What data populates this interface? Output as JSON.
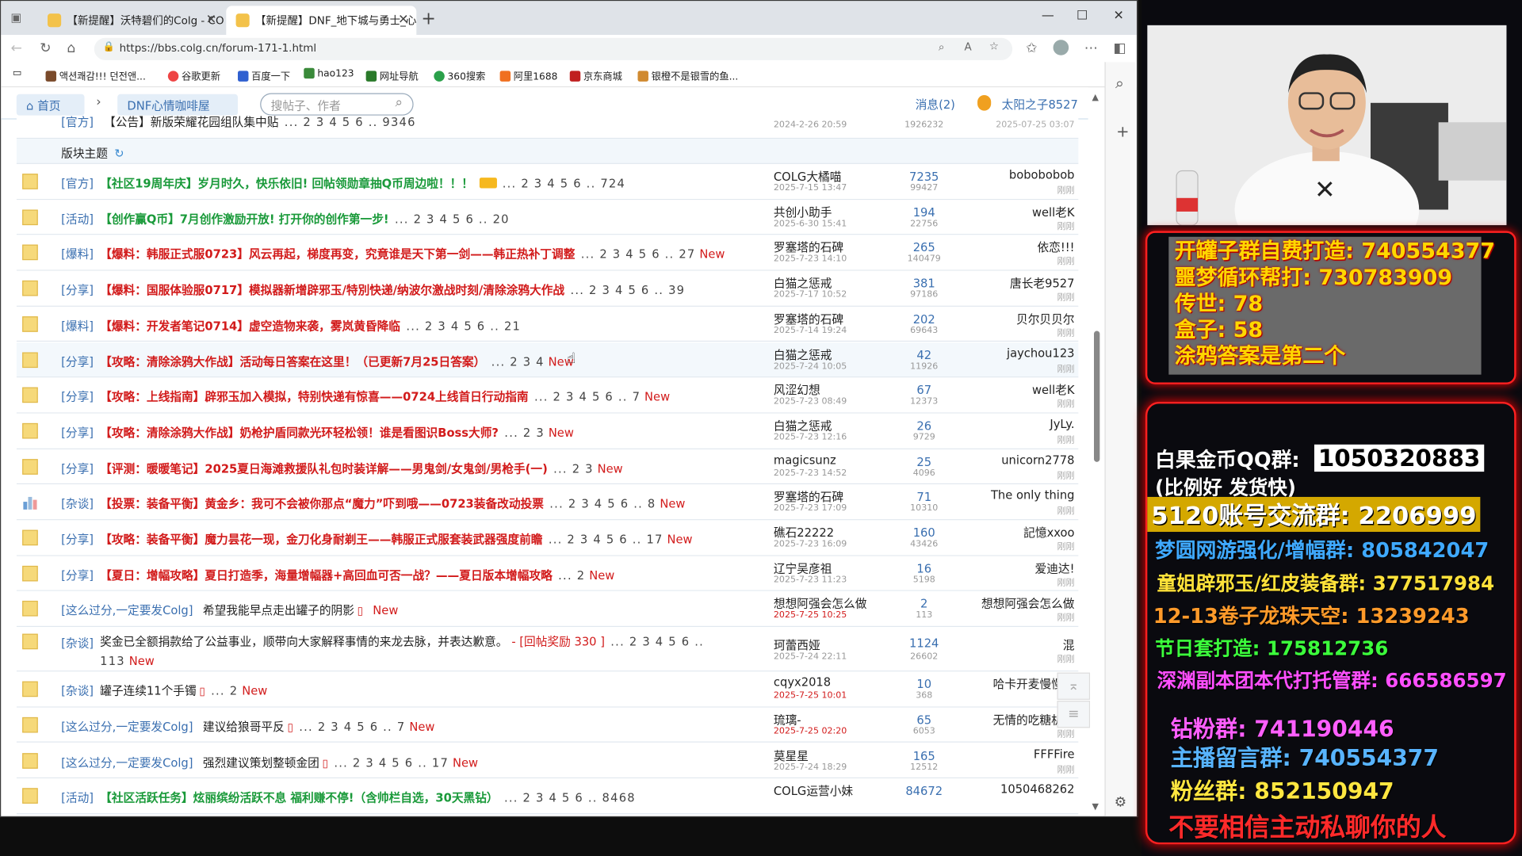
{
  "browser": {
    "tabs": [
      {
        "title": "【新提醒】沃特碧们的Colg - COL"
      },
      {
        "title": "【新提醒】DNF_地下城与勇士_心"
      }
    ],
    "url": "https://bbs.colg.cn/forum-171-1.html",
    "bookmarks": [
      "액션쾌감!!! 던전앤...",
      "谷歌更新",
      "百度一下",
      "hao123",
      "网址导航",
      "360搜索",
      "阿里1688",
      "京东商城",
      "银橙不是银雪的鱼..."
    ]
  },
  "site": {
    "home": "首页",
    "forum": "DNF心情咖啡屋",
    "search_placeholder": "搜帖子、作者",
    "messages": "消息(2)",
    "user": "太阳之子8527",
    "section_label": "版块主题"
  },
  "pinned": {
    "cat": "[官方]",
    "title": "【公告】新版荣耀花园组队集中贴",
    "pages": "... 2 3 4 5 6 .. 9346",
    "date": "2024-2-26 20:59",
    "views": "1926232",
    "lastdate": "2025-07-25 03:07"
  },
  "threads": [
    {
      "cat": "[官方]",
      "title": "【社区19周年庆】岁月时久，快乐依旧! 回帖领勋章抽Q币周边啦！！！",
      "pages": "... 2 3 4 5 6 .. 724",
      "new": "",
      "author": "COLG大橘喵",
      "date": "2025-7-15 13:47",
      "replies": "7235",
      "views": "99427",
      "last": "bobobobob",
      "lt": "刚刚",
      "kind": "green"
    },
    {
      "cat": "[活动]",
      "title": "【创作赢Q币】7月创作激励开放! 打开你的创作第一步!",
      "pages": "... 2 3 4 5 6 .. 20",
      "new": "",
      "author": "共创小助手",
      "date": "2025-6-30 15:41",
      "replies": "194",
      "views": "22756",
      "last": "well老K",
      "lt": "刚刚",
      "kind": "green"
    },
    {
      "cat": "[爆料]",
      "title": "【爆料：韩服正式服0723】风云再起，梯度再变，究竟谁是天下第一剑——韩正热补丁调整",
      "pages": "... 2 3 4 5 6 .. 27",
      "new": "New",
      "author": "罗塞塔的石碑",
      "date": "2025-7-23 14:10",
      "replies": "265",
      "views": "140479",
      "last": "依恋!!!",
      "lt": "刚刚",
      "kind": "blue"
    },
    {
      "cat": "[分享]",
      "title": "【爆料：国服体验服0717】模拟器新增辟邪玉/特別快递/纳波尔激战时刻/清除涂鸦大作战",
      "pages": "... 2 3 4 5 6 .. 39",
      "new": "",
      "author": "白猫之惩戒",
      "date": "2025-7-17 10:52",
      "replies": "381",
      "views": "97186",
      "last": "唐长老9527",
      "lt": "刚刚",
      "kind": "blue"
    },
    {
      "cat": "[爆料]",
      "title": "【爆料：开发者笔记0714】虚空造物来袭，雾岚黄昏降临",
      "pages": "... 2 3 4 5 6 .. 21",
      "new": "",
      "author": "罗塞塔的石碑",
      "date": "2025-7-14 19:24",
      "replies": "202",
      "views": "69643",
      "last": "贝尔贝贝尔",
      "lt": "刚刚",
      "kind": "blue"
    },
    {
      "cat": "[分享]",
      "title": "【攻略：清除涂鸦大作战】活动每日答案在这里！（已更新7月25日答案）",
      "pages": "... 2 3 4",
      "new": "New",
      "author": "白猫之惩戒",
      "date": "2025-7-24 10:05",
      "replies": "42",
      "views": "11926",
      "last": "jaychou123",
      "lt": "刚刚",
      "kind": "red"
    },
    {
      "cat": "[分享]",
      "title": "【攻略：上线指南】辟邪玉加入模拟，特别快递有惊喜——0724上线首日行动指南",
      "pages": "... 2 3 4 5 6 .. 7",
      "new": "New",
      "author": "风涩幻想",
      "date": "2025-7-23 08:49",
      "replies": "67",
      "views": "12373",
      "last": "well老K",
      "lt": "刚刚",
      "kind": "red"
    },
    {
      "cat": "[分享]",
      "title": "【攻略：清除涂鸦大作战】奶枪护盾同款光环轻松领！谁是看图识Boss大师?",
      "pages": "... 2 3",
      "new": "New",
      "author": "白猫之惩戒",
      "date": "2025-7-23 12:16",
      "replies": "26",
      "views": "9729",
      "last": "JyLy.",
      "lt": "刚刚",
      "kind": "red"
    },
    {
      "cat": "[分享]",
      "title": "【评测：暖暖笔记】2025夏日海滩救援队礼包时装详解——男鬼剑/女鬼剑/男枪手(一)",
      "pages": "... 2 3",
      "new": "New",
      "author": "magicsunz",
      "date": "2025-7-23 14:52",
      "replies": "25",
      "views": "4096",
      "last": "unicorn2778",
      "lt": "刚刚",
      "kind": "red"
    },
    {
      "cat": "[杂谈]",
      "title": "【投票：装备平衡】黄金乡：我可不会被你那点“魔力”吓到哦——0723装备改动投票",
      "pages": "... 2 3 4 5 6 .. 8",
      "new": "New",
      "author": "罗塞塔的石碑",
      "date": "2025-7-23 17:09",
      "replies": "71",
      "views": "10310",
      "last": "The only thing",
      "lt": "刚刚",
      "kind": "red",
      "poll": true
    },
    {
      "cat": "[分享]",
      "title": "【攻略：装备平衡】魔力昙花一现，金刀化身耐剃王——韩服正式服套装武器强度前瞻",
      "pages": "... 2 3 4 5 6 .. 17",
      "new": "New",
      "author": "礁石22222",
      "date": "2025-7-23 16:09",
      "replies": "160",
      "views": "43426",
      "last": "記憶xxoo",
      "lt": "刚刚",
      "kind": "red"
    },
    {
      "cat": "[分享]",
      "title": "【夏日：增幅攻略】夏日打造季，海量增幅器+高回血可否一战？——夏日版本增幅攻略",
      "pages": "... 2",
      "new": "New",
      "author": "辽宁吴彦祖",
      "date": "2025-7-23 11:23",
      "replies": "16",
      "views": "5198",
      "last": "爱迪达!",
      "lt": "刚刚",
      "kind": "red"
    },
    {
      "cat": "[这么过分,一定要发Colg]",
      "title": "希望我能早点走出罐子的阴影",
      "pages": "",
      "new": "New",
      "author": "想想阿强会怎么做",
      "date": "2025-7-25 10:25",
      "replies": "2",
      "views": "113",
      "last": "想想阿强会怎么做",
      "lt": "刚刚",
      "kind": "normal",
      "phone": true,
      "reddate": true
    },
    {
      "cat": "[杂谈]",
      "title": "奖金已全额捐款给了公益事业，顺带向大家解释事情的来龙去脉，并表达歉意。",
      "reward": "- [回帖奖励 330 ]",
      "pages": "... 2 3 4 5 6 .. 113",
      "new": "New",
      "author": "珂蕾西娅",
      "date": "2025-7-24 22:11",
      "replies": "1124",
      "views": "26602",
      "last": "混",
      "lt": "刚刚",
      "kind": "normal",
      "tall": true
    },
    {
      "cat": "[杂谈]",
      "title": "罐子连续11个手镯",
      "pages": "... 2",
      "new": "New",
      "author": "cqyx2018",
      "date": "2025-7-25 10:01",
      "replies": "10",
      "views": "368",
      "last": "哈卡开麦慢慢写",
      "lt": "",
      "kind": "normal",
      "phone": true,
      "reddate": true
    },
    {
      "cat": "[这么过分,一定要发Colg]",
      "title": "建议给狼哥平反",
      "pages": "... 2 3 4 5 6 .. 7",
      "new": "New",
      "author": "琉璃-",
      "date": "2025-7-25 02:20",
      "replies": "65",
      "views": "6053",
      "last": "无情的吃糖机器",
      "lt": "刚刚",
      "kind": "normal",
      "phone": true,
      "reddate": true
    },
    {
      "cat": "[这么过分,一定要发Colg]",
      "title": "强烈建议策划整顿金团",
      "pages": "... 2 3 4 5 6 .. 17",
      "new": "New",
      "author": "莫星星",
      "date": "2025-7-24 18:29",
      "replies": "165",
      "views": "12512",
      "last": "FFFFire",
      "lt": "刚刚",
      "kind": "normal",
      "phone": true
    },
    {
      "cat": "[活动]",
      "title": "【社区活跃任务】炫丽缤纷活跃不息 福利赚不停!（含帅栏自选，30天黑钻）",
      "pages": "... 2 3 4 5 6 .. 8468",
      "new": "",
      "author": "COLG运营小妹",
      "date": "",
      "replies": "84672",
      "views": "",
      "last": "1050468262",
      "lt": "",
      "kind": "green"
    }
  ],
  "stream": {
    "panel_lines": [
      "开罐子群自费打造: 740554377",
      "噩梦循环帮打: 730783909",
      "传世: 78",
      "盒子: 58",
      "涂鸦答案是第二个"
    ],
    "group_lines": [
      {
        "text": "白果金币QQ群:",
        "color": "#ffffff"
      },
      {
        "text": "1050320883",
        "color": "#ffffff"
      },
      {
        "text": "(比例好 发货快)",
        "color": "#ffffff"
      },
      {
        "text": "5120账号交流群: 2206999",
        "color": "#ffffff"
      },
      {
        "text": "梦圆网游强化/增幅群: 805842047",
        "color": "#3fa9ff"
      },
      {
        "text": "童姐辟邪玉/红皮装备群: 377517984",
        "color": "#ffe23a"
      },
      {
        "text": "12-13卷子龙珠天空: 13239243",
        "color": "#ff9a2a"
      },
      {
        "text": "节日套打造: 175812736",
        "color": "#3cff3c"
      },
      {
        "text": "深渊副本团本代打托管群: 666586597",
        "color": "#ff4fff"
      },
      {
        "text": "钻粉群: 741190446",
        "color": "#ff5fff"
      },
      {
        "text": "主播留言群: 740554377",
        "color": "#58b4ff"
      },
      {
        "text": "粉丝群: 852150947",
        "color": "#ffe640"
      },
      {
        "text": "不要相信主动私聊你的人",
        "color": "#ff2a2a"
      }
    ]
  }
}
